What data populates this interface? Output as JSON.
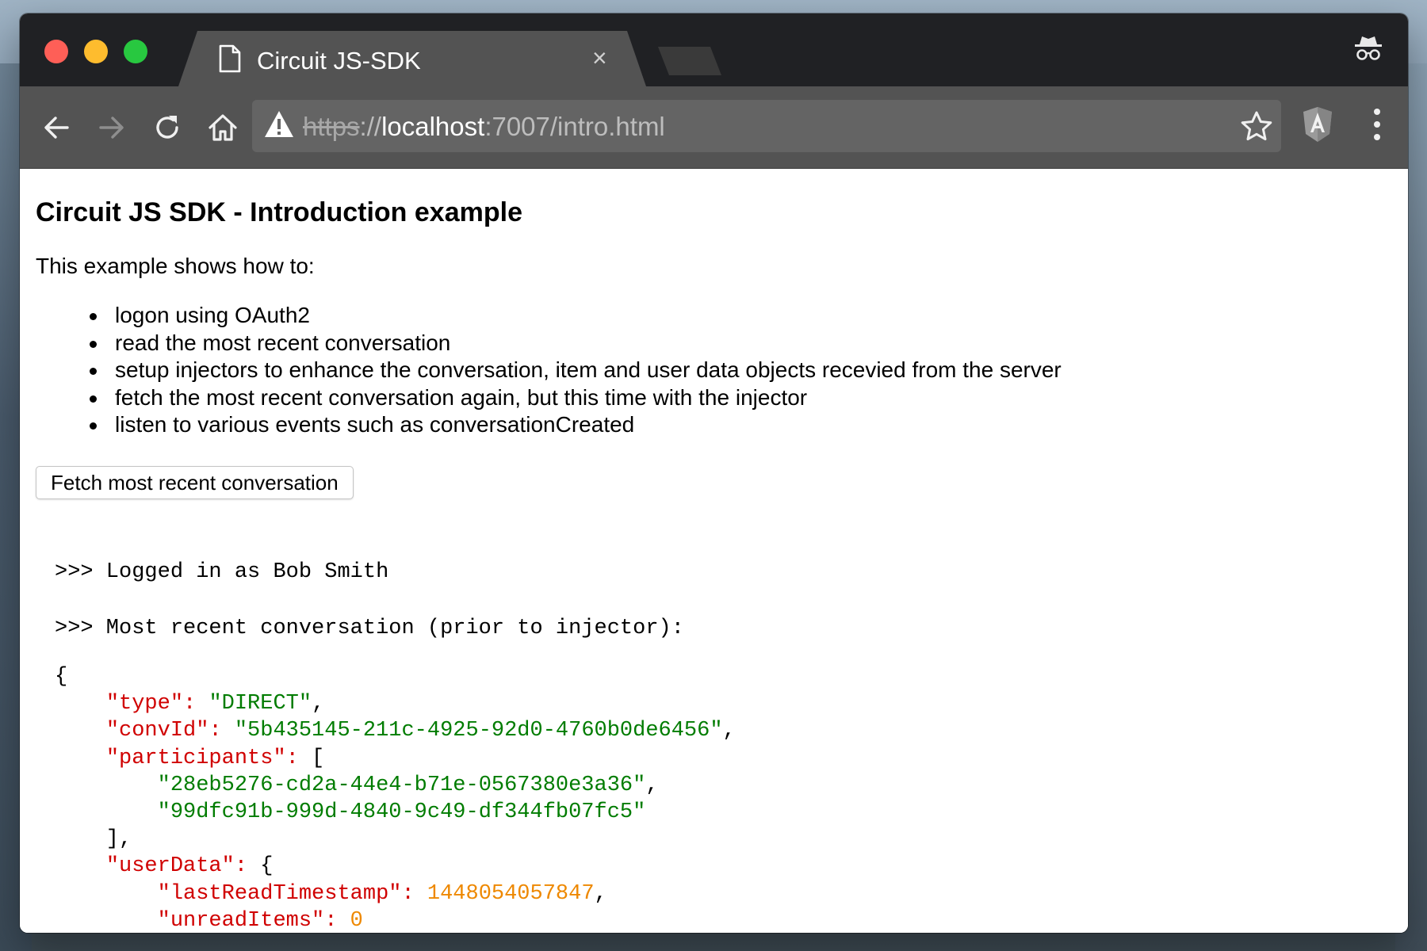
{
  "browser": {
    "tab": {
      "title": "Circuit JS-SDK",
      "close_glyph": "×",
      "icon": "document-icon"
    },
    "url": {
      "scheme": "https",
      "separator": "://",
      "host": "localhost",
      "rest": ":7007/intro.html",
      "security_icon": "warning-icon"
    },
    "toolbar_icons": [
      "back-icon",
      "forward-icon",
      "reload-icon",
      "home-icon",
      "star-icon",
      "angular-extension-icon",
      "menu-icon"
    ],
    "incognito_icon": "incognito-icon"
  },
  "page": {
    "title": "Circuit JS SDK - Introduction example",
    "intro": "This example shows how to:",
    "bullets": [
      "logon using OAuth2",
      "read the most recent conversation",
      "setup injectors to enhance the conversation, item and user data objects recevied from the server",
      "fetch the most recent conversation again, but this time with the injector",
      "listen to various events such as conversationCreated"
    ],
    "fetch_button_label": "Fetch most recent conversation",
    "log": {
      "logged_in": ">>> Logged in as Bob Smith",
      "recent_conv": ">>> Most recent conversation (prior to injector):"
    },
    "json_output": {
      "open_brace": "{",
      "type_key": "\"type\"",
      "type_value": "\"DIRECT\"",
      "convId_key": "\"convId\"",
      "convId_value": "\"5b435145-211c-4925-92d0-4760b0de6456\"",
      "participants_key": "\"participants\"",
      "participant_1": "\"28eb5276-cd2a-44e4-b71e-0567380e3a36\"",
      "participant_2": "\"99dfc91b-999d-4840-9c49-df344fb07fc5\"",
      "userData_key": "\"userData\"",
      "lastReadTimestamp_key": "\"lastReadTimestamp\"",
      "lastReadTimestamp_value": "1448054057847",
      "unreadItems_key": "\"unreadItems\"",
      "unreadItems_value": "0"
    }
  },
  "colors": {
    "json_key": "#d00000",
    "json_string": "#007c00",
    "json_number": "#ee8800",
    "tab_active": "#535353",
    "tabstrip": "#202124"
  }
}
